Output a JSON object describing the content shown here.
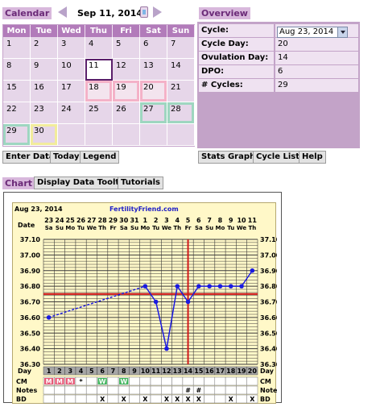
{
  "calendar": {
    "label": "Calendar",
    "date": "Sep 11, 2014",
    "weekdays": [
      "Mon",
      "Tue",
      "Wed",
      "Thu",
      "Fri",
      "Sat",
      "Sun"
    ],
    "weeks": [
      [
        {
          "d": "1"
        },
        {
          "d": "2"
        },
        {
          "d": "3"
        },
        {
          "d": "4"
        },
        {
          "d": "5"
        },
        {
          "d": "6"
        },
        {
          "d": "7"
        }
      ],
      [
        {
          "d": "8"
        },
        {
          "d": "9"
        },
        {
          "d": "10"
        },
        {
          "d": "11",
          "today": true
        },
        {
          "d": "12"
        },
        {
          "d": "13"
        },
        {
          "d": "14"
        }
      ],
      [
        {
          "d": "15"
        },
        {
          "d": "16"
        },
        {
          "d": "17"
        },
        {
          "d": "18",
          "mark": "pink"
        },
        {
          "d": "19",
          "mark": "pink"
        },
        {
          "d": "20",
          "mark": "pink"
        },
        {
          "d": "21"
        }
      ],
      [
        {
          "d": "22"
        },
        {
          "d": "23"
        },
        {
          "d": "24"
        },
        {
          "d": "25"
        },
        {
          "d": "26"
        },
        {
          "d": "27",
          "mark": "green"
        },
        {
          "d": "28",
          "mark": "green"
        }
      ],
      [
        {
          "d": "29",
          "mark": "green"
        },
        {
          "d": "30",
          "mark": "yellow"
        },
        {
          "d": ""
        },
        {
          "d": ""
        },
        {
          "d": ""
        },
        {
          "d": ""
        },
        {
          "d": ""
        }
      ]
    ]
  },
  "overview": {
    "label": "Overview",
    "rows": [
      {
        "key": "Cycle:",
        "value": "Aug 23, 2014",
        "select": true
      },
      {
        "key": "Cycle Day:",
        "value": "20"
      },
      {
        "key": "Ovulation Day:",
        "value": "14"
      },
      {
        "key": "DPO:",
        "value": "6"
      },
      {
        "key": "# Cycles:",
        "value": "29"
      }
    ]
  },
  "buttons": {
    "enter_data": "Enter Data",
    "today": "Today",
    "legend": "Legend",
    "stats_graphs": "Stats Graphs",
    "cycle_list": "Cycle List",
    "help": "Help"
  },
  "chart_tabs": {
    "chart": "Chart",
    "tooltip": "Display Data Tooltip",
    "tutorials": "Tutorials"
  },
  "colors": {
    "accent": "#b27bba",
    "label_text": "#6b2a78",
    "chart_bg": "#fff8c8",
    "temp_line": "#1a1ae0",
    "coverline": "#d01818"
  },
  "chart_data": {
    "type": "line",
    "date_label": "Aug 23, 2014",
    "site": "FertilityFriend.com",
    "dates": [
      "23",
      "24",
      "25",
      "26",
      "27",
      "28",
      "29",
      "30",
      "31",
      "1",
      "2",
      "3",
      "4",
      "5",
      "6",
      "7",
      "8",
      "9",
      "10",
      "11"
    ],
    "weekdays": [
      "Sa",
      "Su",
      "Mo",
      "Tu",
      "We",
      "Th",
      "Fr",
      "Sa",
      "Su",
      "Mo",
      "Tu",
      "We",
      "Th",
      "Fr",
      "Sa",
      "Su",
      "Mo",
      "Tu",
      "We",
      "Th"
    ],
    "days": [
      "1",
      "2",
      "3",
      "4",
      "5",
      "6",
      "7",
      "8",
      "9",
      "10",
      "11",
      "12",
      "13",
      "14",
      "15",
      "16",
      "17",
      "18",
      "19",
      "20"
    ],
    "y_ticks": [
      "37.10",
      "37.00",
      "36.90",
      "36.80",
      "36.70",
      "36.60",
      "36.50",
      "36.40",
      "36.30"
    ],
    "ylim": [
      36.3,
      37.1
    ],
    "temps": [
      [
        1,
        36.6
      ],
      [
        10,
        36.8
      ],
      [
        11,
        36.7
      ],
      [
        12,
        36.4
      ],
      [
        13,
        36.8
      ],
      [
        14,
        36.7
      ],
      [
        15,
        36.8
      ],
      [
        16,
        36.8
      ],
      [
        17,
        36.8
      ],
      [
        18,
        36.8
      ],
      [
        19,
        36.8
      ],
      [
        20,
        36.9
      ]
    ],
    "coverline": 36.75,
    "ovulation_day": 14,
    "row_labels": {
      "date": "Date",
      "day": "Day",
      "cm": "CM",
      "notes": "Notes",
      "bd": "BD"
    },
    "cm": [
      {
        "day": 1,
        "text": "M",
        "color": "#e85a78"
      },
      {
        "day": 2,
        "text": "M",
        "color": "#e85a78"
      },
      {
        "day": 3,
        "text": "M",
        "color": "#e85a78"
      },
      {
        "day": 4,
        "text": "*",
        "color": ""
      },
      {
        "day": 6,
        "text": "W",
        "color": "#3db45a"
      },
      {
        "day": 8,
        "text": "W",
        "color": "#3db45a"
      }
    ],
    "notes": [
      {
        "day": 14,
        "text": "#"
      },
      {
        "day": 15,
        "text": "#"
      }
    ],
    "bd": [
      {
        "day": 6,
        "text": "X"
      },
      {
        "day": 8,
        "text": "X"
      },
      {
        "day": 10,
        "text": "X"
      },
      {
        "day": 12,
        "text": "X"
      },
      {
        "day": 13,
        "text": "X"
      },
      {
        "day": 14,
        "text": "X"
      },
      {
        "day": 15,
        "text": "X"
      },
      {
        "day": 18,
        "text": "X"
      },
      {
        "day": 20,
        "text": "X"
      }
    ]
  }
}
